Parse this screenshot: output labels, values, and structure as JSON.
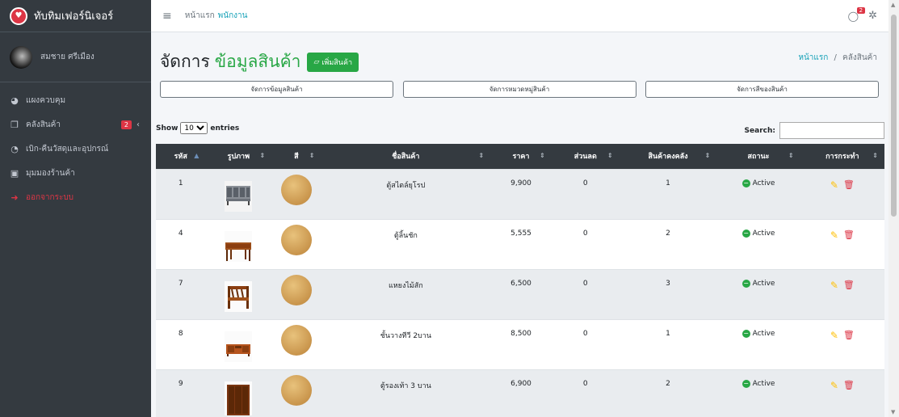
{
  "brand": {
    "name": "ทับทิมเฟอร์นิเจอร์"
  },
  "user": {
    "name": "สมชาย ศรีเมือง"
  },
  "sidebar": {
    "items": [
      {
        "label": "แผงควบคุม",
        "icon": "dashboard-icon"
      },
      {
        "label": "คลังสินค้า",
        "icon": "copy-icon",
        "badge": "2"
      },
      {
        "label": "เบิก-คืนวัสดุและอุปกรณ์",
        "icon": "pie-chart-icon"
      },
      {
        "label": "มุมมองร้านค้า",
        "icon": "window-icon"
      },
      {
        "label": "ออกจากระบบ",
        "icon": "sign-out-icon"
      }
    ]
  },
  "topbar": {
    "home": "หน้าแรก",
    "employee": "พนักงาน",
    "message_badge": "2"
  },
  "page": {
    "title": "จัดการ",
    "title_highlight": "ข้อมูลสินค้า",
    "add_button": "เพิ่มสินค้า",
    "breadcrumb_home": "หน้าแรก",
    "breadcrumb_sep": "/",
    "breadcrumb_current": "คลังสินค้า"
  },
  "menu_buttons": [
    "จัดการข้อมูลสินค้า",
    "จัดการหมวดหมู่สินค้า",
    "จัดการสีของสินค้า"
  ],
  "table_controls": {
    "show_label": "Show",
    "entries_label": "entries",
    "page_size": "10",
    "search_label": "Search:",
    "search_value": ""
  },
  "table": {
    "headers": [
      "รหัส",
      "รูปภาพ",
      "สี",
      "ชื่อสินค้า",
      "ราคา",
      "ส่วนลด",
      "สินค้าคงคลัง",
      "สถานะ",
      "การกระทำ"
    ],
    "rows": [
      {
        "id": "1",
        "name": "ตู้สไตล์ยุโรป",
        "price": "9,900",
        "discount": "0",
        "stock": "1",
        "status": "Active",
        "image": "cabinet-image"
      },
      {
        "id": "4",
        "name": "ตู้ลิ้นชัก",
        "price": "5,555",
        "discount": "0",
        "stock": "2",
        "status": "Active",
        "image": "drawer-table-image"
      },
      {
        "id": "7",
        "name": "แหยงไม้สัก",
        "price": "6,500",
        "discount": "0",
        "stock": "3",
        "status": "Active",
        "image": "teak-chair-image"
      },
      {
        "id": "8",
        "name": "ชั้นวางทีวี 2บาน",
        "price": "8,500",
        "discount": "0",
        "stock": "1",
        "status": "Active",
        "image": "tv-stand-image"
      },
      {
        "id": "9",
        "name": "ตู้รองเท้า 3 บาน",
        "price": "6,900",
        "discount": "0",
        "stock": "2",
        "status": "Active",
        "image": "shoe-cabinet-image"
      }
    ]
  },
  "colors": {
    "accent": "#28a745",
    "sidebar": "#343a40",
    "link": "#17a2b8",
    "danger": "#dc3545"
  }
}
